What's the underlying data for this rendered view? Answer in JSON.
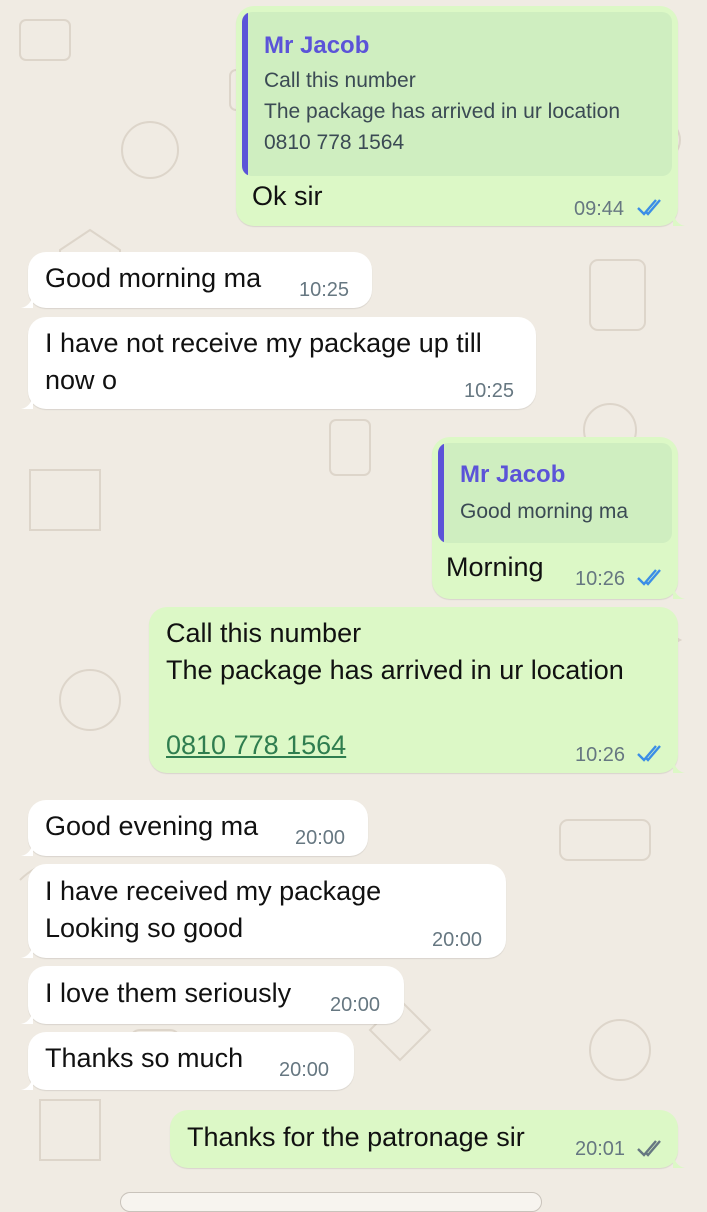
{
  "chat": {
    "messages": [
      {
        "dir": "out",
        "quote": {
          "author": "Mr Jacob",
          "lines": [
            "Call this number",
            "The package has arrived in ur location",
            "0810 778 1564"
          ]
        },
        "text": "Ok sir",
        "time": "09:44",
        "status": "read"
      },
      {
        "dir": "in",
        "text": "Good morning ma",
        "time": "10:25"
      },
      {
        "dir": "in",
        "lines": [
          "I have not receive my package up till",
          "now o"
        ],
        "time": "10:25"
      },
      {
        "dir": "out",
        "quote": {
          "author": "Mr Jacob",
          "lines": [
            "Good morning ma"
          ]
        },
        "text": "Morning",
        "time": "10:26",
        "status": "read"
      },
      {
        "dir": "out",
        "lines": [
          "Call this number",
          "The package has arrived in ur location"
        ],
        "link": "0810 778 1564",
        "time": "10:26",
        "status": "read"
      },
      {
        "dir": "in",
        "text": "Good evening ma",
        "time": "20:00"
      },
      {
        "dir": "in",
        "lines": [
          "I have received my package",
          "Looking so good"
        ],
        "time": "20:00"
      },
      {
        "dir": "in",
        "text": "I love them seriously",
        "time": "20:00"
      },
      {
        "dir": "in",
        "text": "Thanks so much",
        "time": "20:00"
      },
      {
        "dir": "out",
        "text": "Thanks for the patronage sir",
        "time": "20:01",
        "status": "delivered"
      }
    ]
  },
  "colors": {
    "wallpaper": "#f0ebe3",
    "incoming_bubble": "#ffffff",
    "outgoing_bubble": "#dcf8c6",
    "quote_bar": "#5b53d8",
    "read_ticks": "#3b8ee6",
    "delivered_ticks": "#667781",
    "link": "#2f7d4f"
  },
  "icons": {
    "read": "double-check-blue-icon",
    "delivered": "double-check-grey-icon"
  }
}
